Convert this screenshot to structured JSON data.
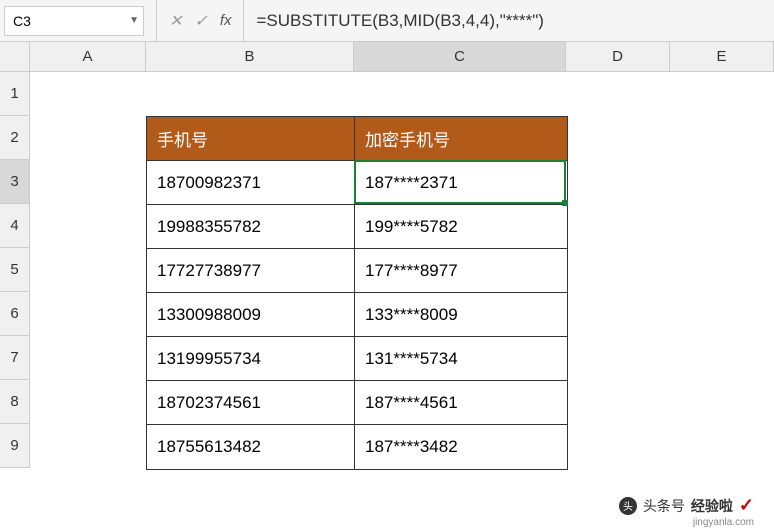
{
  "name_box": {
    "value": "C3"
  },
  "formula_bar": {
    "formula": "=SUBSTITUTE(B3,MID(B3,4,4),\"****\")"
  },
  "columns": [
    "A",
    "B",
    "C",
    "D",
    "E"
  ],
  "rows": [
    "1",
    "2",
    "3",
    "4",
    "5",
    "6",
    "7",
    "8",
    "9"
  ],
  "chart_data": {
    "type": "table",
    "title": "",
    "headers": [
      "手机号",
      "加密手机号"
    ],
    "data": [
      {
        "phone": "18700982371",
        "masked": "187****2371"
      },
      {
        "phone": "19988355782",
        "masked": "199****5782"
      },
      {
        "phone": "17727738977",
        "masked": "177****8977"
      },
      {
        "phone": "13300988009",
        "masked": "133****8009"
      },
      {
        "phone": "13199955734",
        "masked": "131****5734"
      },
      {
        "phone": "18702374561",
        "masked": "187****4561"
      },
      {
        "phone": "18755613482",
        "masked": "187****3482"
      }
    ]
  },
  "active_cell": {
    "ref": "C3",
    "col": "C",
    "row": "3"
  },
  "watermark": {
    "text1": "头条号",
    "text2": "经验啦",
    "sub": "jingyanla.com"
  },
  "colors": {
    "header_bg": "#b15a1a",
    "header_fg": "#ffffff",
    "active_border": "#1a7f37"
  }
}
